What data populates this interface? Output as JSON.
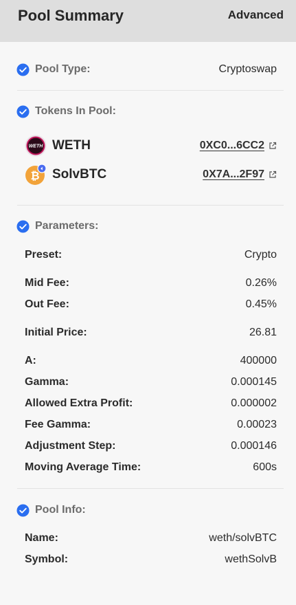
{
  "header": {
    "title": "Pool Summary",
    "advanced_label": "Advanced"
  },
  "pool_type": {
    "label": "Pool Type:",
    "value": "Cryptoswap"
  },
  "tokens": {
    "section_title": "Tokens In Pool:",
    "items": [
      {
        "symbol": "WETH",
        "address": "0XC0...6CC2",
        "logo_text": "WETH"
      },
      {
        "symbol": "SolvBTC",
        "address": "0X7A...2F97"
      }
    ]
  },
  "parameters": {
    "section_title": "Parameters:",
    "rows": [
      {
        "label": "Preset:",
        "value": "Crypto"
      },
      {
        "label": "Mid Fee:",
        "value": "0.26%"
      },
      {
        "label": "Out Fee:",
        "value": "0.45%"
      },
      {
        "label": "Initial Price:",
        "value": "26.81"
      },
      {
        "label": "A:",
        "value": "400000"
      },
      {
        "label": "Gamma:",
        "value": "0.000145"
      },
      {
        "label": "Allowed Extra Profit:",
        "value": "0.000002"
      },
      {
        "label": "Fee Gamma:",
        "value": "0.00023"
      },
      {
        "label": "Adjustment Step:",
        "value": "0.000146"
      },
      {
        "label": "Moving Average Time:",
        "value": "600s"
      }
    ]
  },
  "pool_info": {
    "section_title": "Pool Info:",
    "rows": [
      {
        "label": "Name:",
        "value": "weth/solvBTC"
      },
      {
        "label": "Symbol:",
        "value": "wethSolvB"
      }
    ]
  },
  "colors": {
    "check_blue": "#2a6ef0",
    "header_bg": "#dedede",
    "page_bg": "#f7f7f7"
  }
}
